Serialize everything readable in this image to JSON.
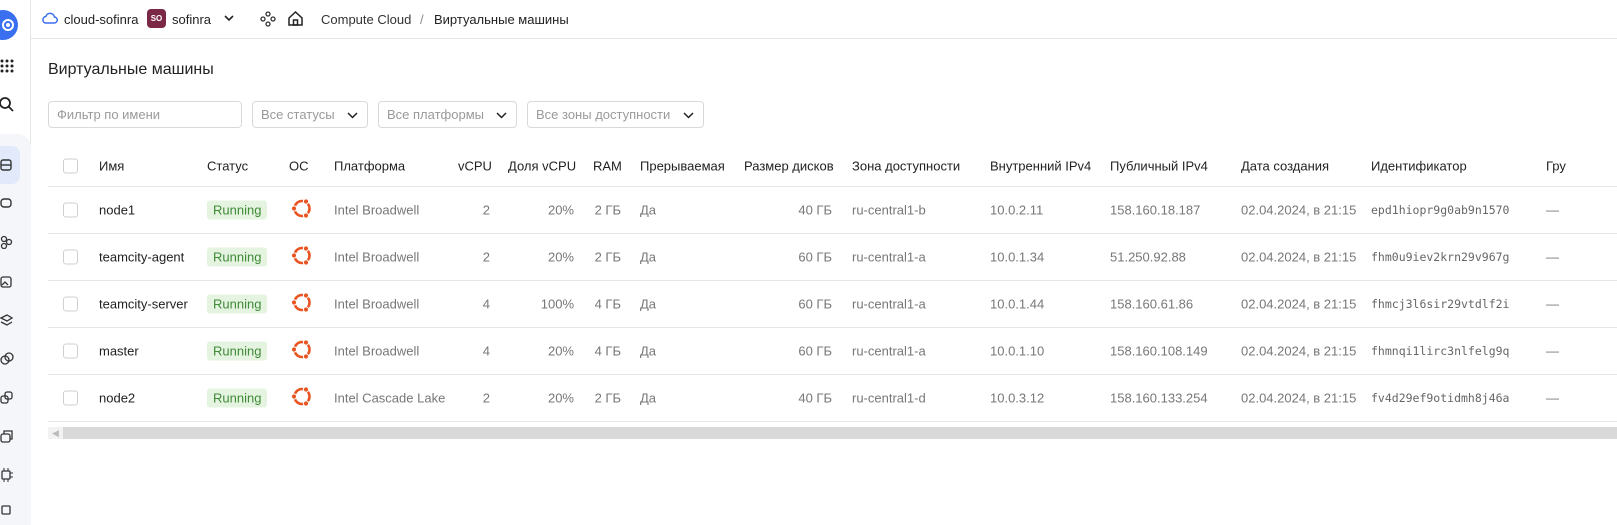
{
  "header": {
    "cloud_name": "cloud-sofinra",
    "org_badge": "SO",
    "org_name": "sofinra",
    "breadcrumb_service": "Compute Cloud",
    "breadcrumb_sep": "/",
    "breadcrumb_page": "Виртуальные машины"
  },
  "page": {
    "title": "Виртуальные машины"
  },
  "filters": {
    "name_placeholder": "Фильтр по имени",
    "status": "Все статусы",
    "platform": "Все платформы",
    "zone": "Все зоны доступности"
  },
  "table": {
    "columns": {
      "name": "Имя",
      "status": "Статус",
      "os": "ОС",
      "platform": "Платформа",
      "vcpu": "vCPU",
      "vcpu_share": "Доля vCPU",
      "ram": "RAM",
      "preemptible": "Прерываемая",
      "disk_size": "Размер дисков",
      "zone": "Зона доступности",
      "internal_ip": "Внутренний IPv4",
      "public_ip": "Публичный IPv4",
      "created": "Дата создания",
      "id": "Идентификатор",
      "group": "Гру"
    },
    "rows": [
      {
        "name": "node1",
        "status": "Running",
        "platform": "Intel Broadwell",
        "vcpu": "2",
        "vcpu_share": "20%",
        "ram": "2 ГБ",
        "preemptible": "Да",
        "disk": "40 ГБ",
        "zone": "ru-central1-b",
        "internal_ip": "10.0.2.11",
        "public_ip": "158.160.18.187",
        "created": "02.04.2024, в 21:15",
        "id": "epd1hiopr9g0ab9n1570",
        "group": "—"
      },
      {
        "name": "teamcity-agent",
        "status": "Running",
        "platform": "Intel Broadwell",
        "vcpu": "2",
        "vcpu_share": "20%",
        "ram": "2 ГБ",
        "preemptible": "Да",
        "disk": "60 ГБ",
        "zone": "ru-central1-a",
        "internal_ip": "10.0.1.34",
        "public_ip": "51.250.92.88",
        "created": "02.04.2024, в 21:15",
        "id": "fhm0u9iev2krn29v967g",
        "group": "—"
      },
      {
        "name": "teamcity-server",
        "status": "Running",
        "platform": "Intel Broadwell",
        "vcpu": "4",
        "vcpu_share": "100%",
        "ram": "4 ГБ",
        "preemptible": "Да",
        "disk": "60 ГБ",
        "zone": "ru-central1-a",
        "internal_ip": "10.0.1.44",
        "public_ip": "158.160.61.86",
        "created": "02.04.2024, в 21:15",
        "id": "fhmcj3l6sir29vtdlf2i",
        "group": "—"
      },
      {
        "name": "master",
        "status": "Running",
        "platform": "Intel Broadwell",
        "vcpu": "4",
        "vcpu_share": "20%",
        "ram": "4 ГБ",
        "preemptible": "Да",
        "disk": "60 ГБ",
        "zone": "ru-central1-a",
        "internal_ip": "10.0.1.10",
        "public_ip": "158.160.108.149",
        "created": "02.04.2024, в 21:15",
        "id": "fhmnqi1lirc3nlfelg9q",
        "group": "—"
      },
      {
        "name": "node2",
        "status": "Running",
        "platform": "Intel Cascade Lake",
        "vcpu": "2",
        "vcpu_share": "20%",
        "ram": "2 ГБ",
        "preemptible": "Да",
        "disk": "40 ГБ",
        "zone": "ru-central1-d",
        "internal_ip": "10.0.3.12",
        "public_ip": "158.160.133.254",
        "created": "02.04.2024, в 21:15",
        "id": "fv4d29ef9otidmh8j46a",
        "group": "—"
      }
    ]
  },
  "colors": {
    "accent": "#3a6ff0",
    "status_running_bg": "#e4f4e0",
    "status_running_text": "#3f8a37",
    "ubuntu_orange": "#e95420",
    "org_badge": "#7a2846"
  },
  "icons": {
    "os": "ubuntu-icon"
  }
}
